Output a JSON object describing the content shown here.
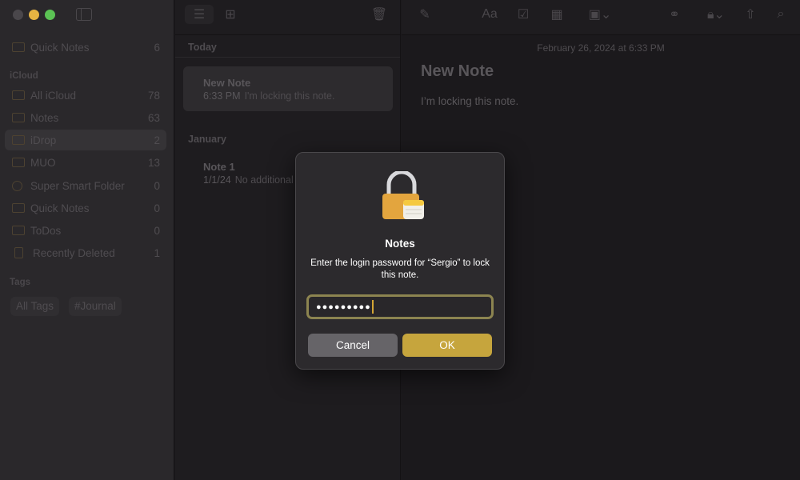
{
  "window": {
    "traffic_colors": [
      "#4a474b",
      "#e7b442",
      "#5bc254"
    ]
  },
  "sidebar": {
    "pinned": {
      "label": "Quick Notes",
      "count": "6"
    },
    "icloud_title": "iCloud",
    "items": [
      {
        "label": "All iCloud",
        "count": "78",
        "icon": "folder-icon"
      },
      {
        "label": "Notes",
        "count": "63",
        "icon": "folder-icon"
      },
      {
        "label": "iDrop",
        "count": "2",
        "icon": "folder-icon",
        "selected": true
      },
      {
        "label": "MUO",
        "count": "13",
        "icon": "folder-icon"
      },
      {
        "label": "Super Smart Folder",
        "count": "0",
        "icon": "gear-icon"
      },
      {
        "label": "Quick Notes",
        "count": "0",
        "icon": "folder-icon"
      },
      {
        "label": "ToDos",
        "count": "0",
        "icon": "folder-icon"
      },
      {
        "label": "Recently Deleted",
        "count": "1",
        "icon": "trash-icon"
      }
    ],
    "tags_title": "Tags",
    "tags": [
      "All Tags",
      "#Journal"
    ]
  },
  "list": {
    "sections": [
      {
        "title": "Today",
        "notes": [
          {
            "title": "New Note",
            "time": "6:33 PM",
            "preview": "I'm locking this note."
          }
        ]
      },
      {
        "title": "January",
        "notes": [
          {
            "title": "Note 1",
            "time": "1/1/24",
            "preview": "No additional text"
          }
        ]
      }
    ]
  },
  "editor": {
    "date": "February 26, 2024 at 6:33 PM",
    "title": "New Note",
    "body": "I’m locking this note.",
    "format_label": "Aa"
  },
  "dialog": {
    "title": "Notes",
    "message": "Enter the login password for “Sergio” to lock this note.",
    "password_mask": "●●●●●●●●●",
    "cancel_label": "Cancel",
    "ok_label": "OK",
    "accent": "#c6a53d"
  }
}
